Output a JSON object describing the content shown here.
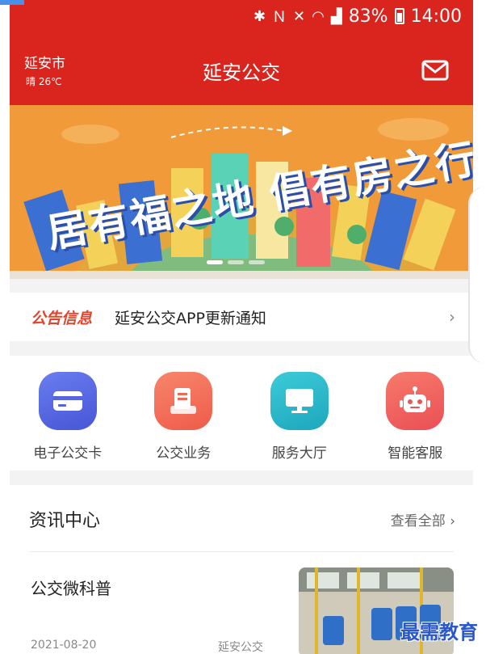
{
  "status_bar": {
    "icons": [
      "bluetooth-icon",
      "nfc-icon",
      "vibrate-icon",
      "wifi-icon",
      "signal-icon"
    ],
    "battery": "83%",
    "time": "14:00"
  },
  "header": {
    "city": "延安市",
    "weather": "晴 26℃",
    "title": "延安公交",
    "mail_icon": "mail-icon"
  },
  "banner": {
    "slogan": "居有福之地 倡有房之行",
    "dot_count": 3,
    "active_dot": 0
  },
  "notice": {
    "tag": "公告信息",
    "text": "延安公交APP更新通知"
  },
  "services": [
    {
      "label": "电子公交卡",
      "icon": "card-icon",
      "color": "#5a6be8"
    },
    {
      "label": "公交业务",
      "icon": "document-icon",
      "color": "#f1705a"
    },
    {
      "label": "服务大厅",
      "icon": "monitor-icon",
      "color": "#27b6c9"
    },
    {
      "label": "智能客服",
      "icon": "robot-icon",
      "color": "#f05a5a"
    }
  ],
  "news": {
    "title": "资讯中心",
    "more": "查看全部",
    "item": {
      "title": "公交微科普",
      "date": "2021-08-20",
      "source": "延安公交"
    }
  },
  "watermark": "最需教育",
  "colors": {
    "brand_red": "#d9251d",
    "banner_orange": "#f09a3a"
  }
}
